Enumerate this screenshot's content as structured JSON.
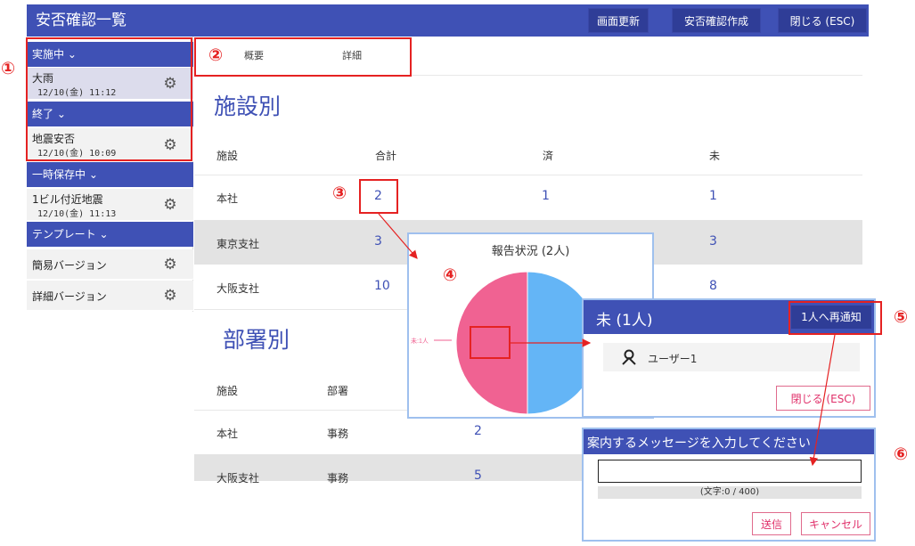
{
  "header": {
    "title": "安否確認一覧",
    "refresh_label": "画面更新",
    "create_label": "安否確認作成",
    "close_label": "閉じる (ESC)"
  },
  "sidebar": {
    "sections": [
      {
        "label": "実施中 ⌄",
        "items": [
          {
            "name": "大雨",
            "date": "12/10(金) 11:12"
          }
        ]
      },
      {
        "label": "終了 ⌄",
        "items": [
          {
            "name": "地震安否",
            "date": "12/10(金) 10:09"
          }
        ]
      },
      {
        "label": "一時保存中 ⌄",
        "items": [
          {
            "name": "1ビル付近地震",
            "date": "12/10(金) 11:13"
          }
        ]
      },
      {
        "label": "テンプレート ⌄",
        "items": [
          {
            "name": "簡易バージョン"
          },
          {
            "name": "詳細バージョン"
          }
        ]
      }
    ]
  },
  "tabs": [
    "概要",
    "詳細"
  ],
  "facility_section": {
    "title": "施設別",
    "headers": [
      "施設",
      "合計",
      "済",
      "未"
    ],
    "rows": [
      {
        "name": "本社",
        "total": "2",
        "done": "1",
        "pending": "1"
      },
      {
        "name": "東京支社",
        "total": "3",
        "done": "",
        "pending": "3"
      },
      {
        "name": "大阪支社",
        "total": "10",
        "done": "",
        "pending": "8"
      }
    ]
  },
  "dept_section": {
    "title": "部署別",
    "headers": [
      "施設",
      "部署"
    ],
    "rows": [
      {
        "facility": "本社",
        "dept": "事務",
        "total": "2"
      },
      {
        "facility": "大阪支社",
        "dept": "事務",
        "total": "5"
      }
    ]
  },
  "chart_data": {
    "type": "pie",
    "title": "報告状況 (2人)",
    "slices": [
      {
        "label": "未:1人",
        "value": 1,
        "color": "#f06292"
      },
      {
        "label": "",
        "value": 1,
        "color": "#64b5f6"
      }
    ]
  },
  "list_popup": {
    "title": "未 (1人)",
    "resend_label": "1人へ再通知",
    "users": [
      "ユーザー1"
    ],
    "close_label": "閉じる (ESC)"
  },
  "message_popup": {
    "title": "案内するメッセージを入力してください",
    "input_value": "",
    "counter": "(文字:0 / 400)",
    "send_label": "送信",
    "cancel_label": "キャンセル"
  },
  "annotations": [
    "①",
    "②",
    "③",
    "④",
    "⑤",
    "⑥"
  ],
  "colors": {
    "primary": "#3f51b5",
    "annotation": "#e52222",
    "pending": "#f06292",
    "done": "#64b5f6"
  }
}
